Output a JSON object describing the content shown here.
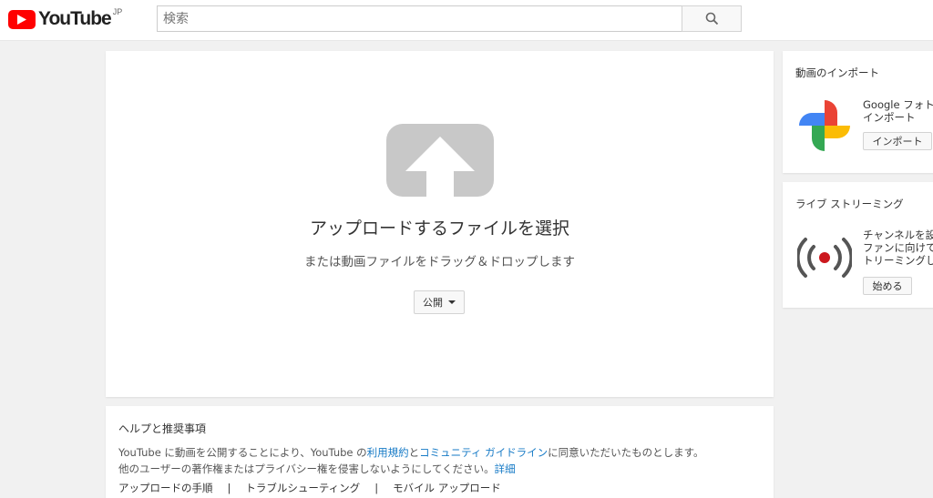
{
  "header": {
    "logo_text": "YouTube",
    "region": "JP",
    "search_placeholder": "検索"
  },
  "upload": {
    "title": "アップロードするファイルを選択",
    "subtitle": "または動画ファイルをドラッグ＆ドロップします",
    "privacy_label": "公開"
  },
  "help": {
    "title": "ヘルプと推奨事項",
    "line1_pre": "YouTube に動画を公開することにより、YouTube の",
    "terms_link": "利用規約",
    "and": "と",
    "guidelines_link": "コミュニティ ガイドライン",
    "line1_post": "に同意いただいたものとします。",
    "line2_pre": "他のユーザーの著作権またはプライバシー権を侵害しないようにしてください。",
    "details_link": "詳細",
    "links": [
      "アップロードの手順",
      "トラブルシューティング",
      "モバイル アップロード"
    ],
    "separator": "|"
  },
  "import_card": {
    "title": "動画のインポート",
    "text_line1": "Google フォト",
    "text_line2": "インポート",
    "button": "インポート"
  },
  "live_card": {
    "title": "ライブ ストリーミング",
    "text_line1": "チャンネルを設",
    "text_line2": "ファンに向けて",
    "text_line3": "トリーミングし",
    "button": "始める"
  },
  "colors": {
    "brand_red": "#ff0000",
    "link_blue": "#167ac6",
    "page_bg": "#f1f1f1"
  }
}
